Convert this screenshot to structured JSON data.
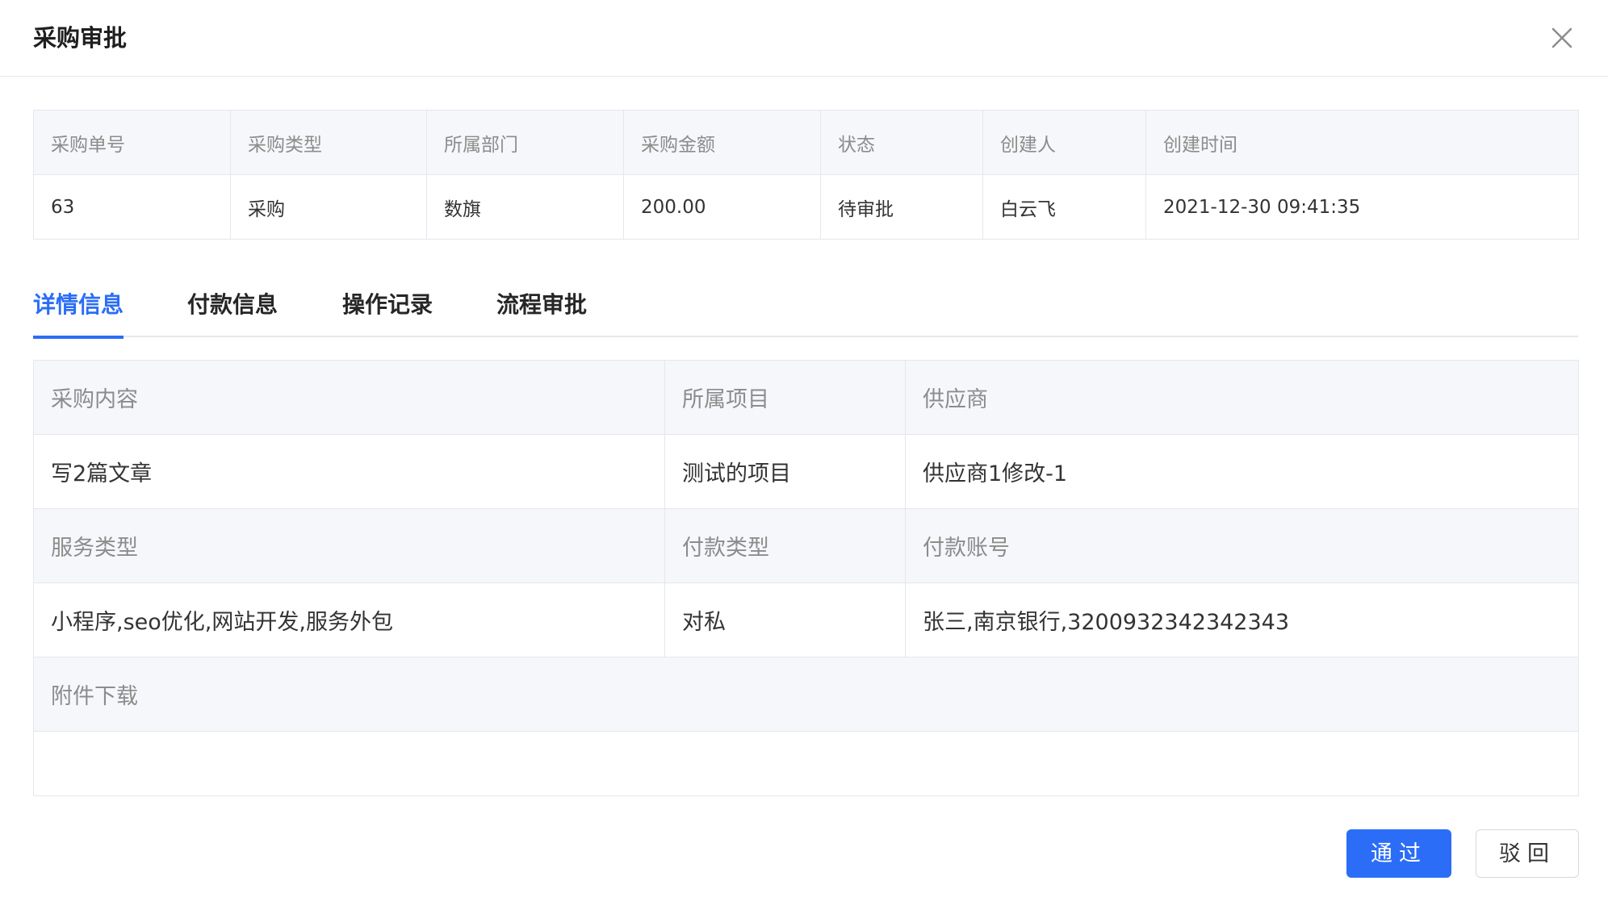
{
  "dialog": {
    "title": "采购审批"
  },
  "summary": {
    "headers": [
      "采购单号",
      "采购类型",
      "所属部门",
      "采购金额",
      "状态",
      "创建人",
      "创建时间"
    ],
    "values": [
      "63",
      "采购",
      "数旗",
      "200.00",
      "待审批",
      "白云飞",
      "2021-12-30 09:41:35"
    ]
  },
  "tabs": [
    {
      "label": "详情信息",
      "active": true
    },
    {
      "label": "付款信息",
      "active": false
    },
    {
      "label": "操作记录",
      "active": false
    },
    {
      "label": "流程审批",
      "active": false
    }
  ],
  "detail": {
    "row1_labels": [
      "采购内容",
      "所属项目",
      "供应商"
    ],
    "row1_values": [
      "写2篇文章",
      "测试的项目",
      "供应商1修改-1"
    ],
    "row2_labels": [
      "服务类型",
      "付款类型",
      "付款账号"
    ],
    "row2_values": [
      "小程序,seo优化,网站开发,服务外包",
      "对私",
      "张三,南京银行,3200932342342343"
    ],
    "attachment_label": "附件下载"
  },
  "buttons": {
    "approve": "通过",
    "reject": "驳回"
  },
  "colors": {
    "accent": "#2b6df6",
    "header_bg": "#f5f7fa",
    "border": "#e4e7ed"
  }
}
